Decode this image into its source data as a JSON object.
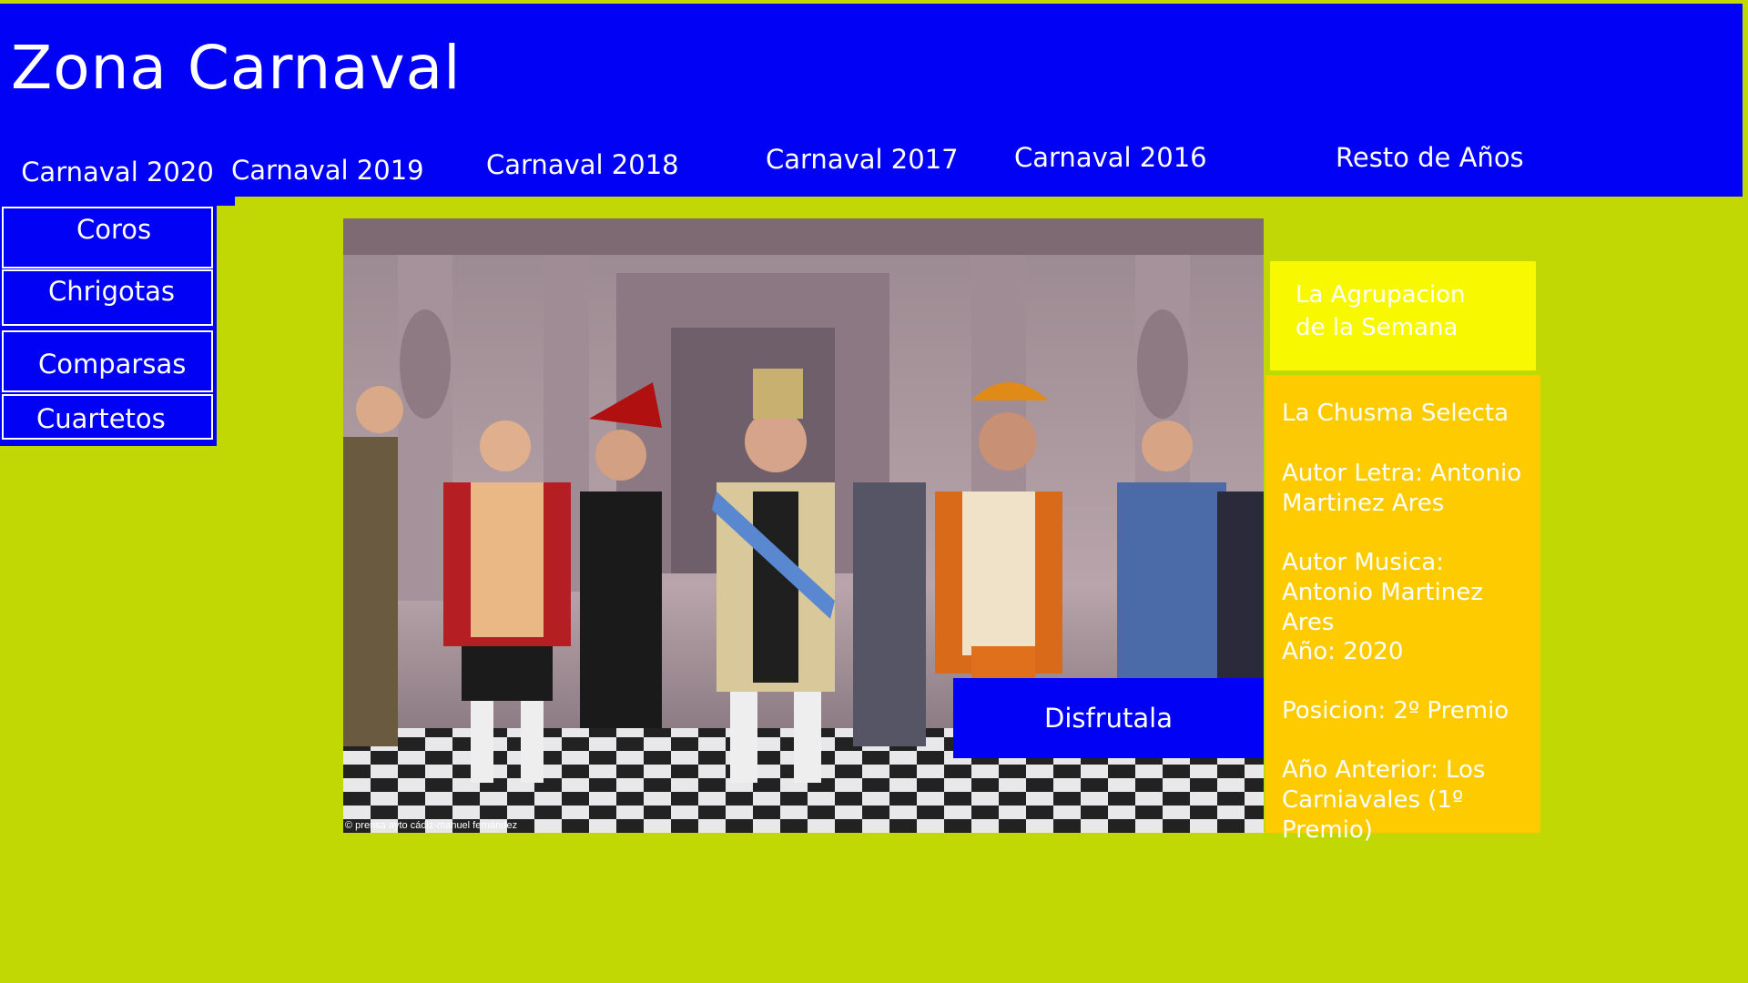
{
  "header": {
    "title": "Zona Carnaval",
    "tabs": [
      {
        "label": "Carnaval 2020"
      },
      {
        "label": "Carnaval 2019"
      },
      {
        "label": "Carnaval 2018"
      },
      {
        "label": "Carnaval 2017"
      },
      {
        "label": "Carnaval 2016"
      },
      {
        "label": "Resto de Años"
      }
    ]
  },
  "side_menu": {
    "items": [
      {
        "label": "Coros"
      },
      {
        "label": "Chrigotas"
      },
      {
        "label": "Comparsas"
      },
      {
        "label": "Cuartetos"
      }
    ]
  },
  "photo": {
    "credit": "© prensa ayto cádiz-manuel fernández",
    "cta_label": "Disfrutala"
  },
  "week": {
    "line1": "La Agrupacion",
    "line2": "de la Semana"
  },
  "info": {
    "name": "La Chusma Selecta",
    "lyrics_author": "Autor Letra: Antonio Martinez Ares",
    "music_author": "Autor Musica: Antonio Martinez Ares",
    "year": "Año: 2020",
    "position": "Posicion: 2º Premio",
    "previous": "Año Anterior: Los Carniavales (1º Premio)"
  },
  "colors": {
    "background": "#c2d805",
    "primary_blue": "#0101f6",
    "week_yellow": "#f8f800",
    "info_orange": "#fecb00"
  }
}
